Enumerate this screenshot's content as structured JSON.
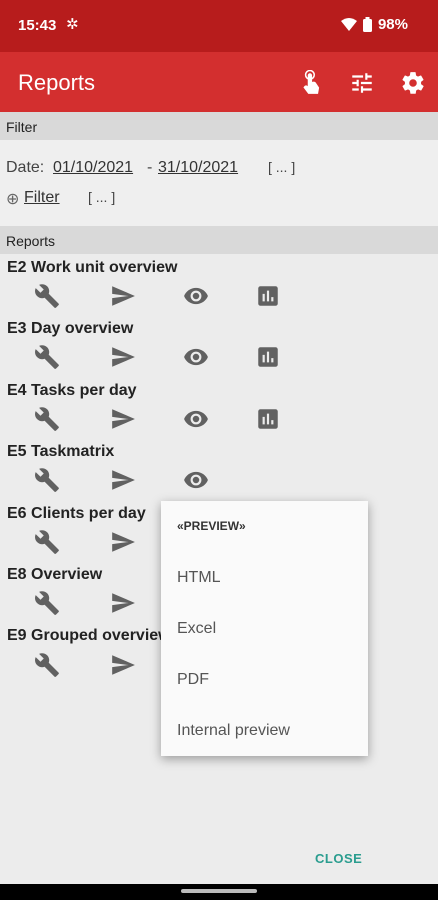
{
  "status": {
    "time": "15:43",
    "battery": "98%"
  },
  "appbar": {
    "title": "Reports"
  },
  "filter": {
    "header": "Filter",
    "date_label": "Date:",
    "date_from": "01/10/2021",
    "date_sep": "-",
    "date_to": "31/10/2021",
    "date_more": "[ ... ]",
    "filter_prefix": "⊕",
    "filter_link": "Filter",
    "filter_more": "[ ... ]"
  },
  "reports": {
    "header": "Reports",
    "items": [
      {
        "title": "E2 Work unit overview"
      },
      {
        "title": "E3 Day overview"
      },
      {
        "title": "E4 Tasks per day"
      },
      {
        "title": "E5 Taskmatrix"
      },
      {
        "title": "E6 Clients per day"
      },
      {
        "title": "E8 Overview"
      },
      {
        "title": "E9 Grouped overview"
      }
    ]
  },
  "popup": {
    "header": "«PREVIEW»",
    "options": [
      "HTML",
      "Excel",
      "PDF",
      "Internal preview"
    ]
  },
  "footer": {
    "close_label": "CLOSE"
  }
}
